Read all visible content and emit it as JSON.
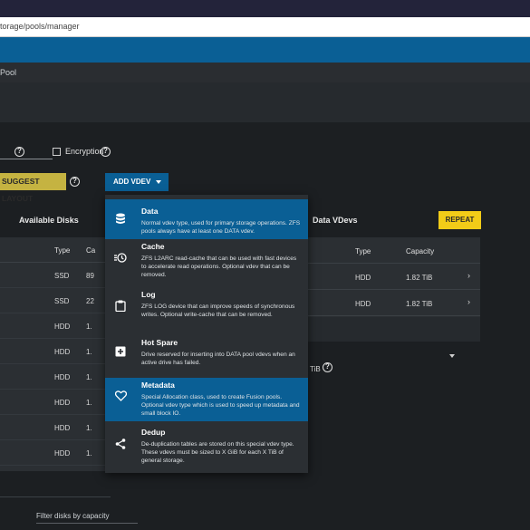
{
  "browser": {
    "url": "torage/pools/manager"
  },
  "breadcrumb": {
    "text": "Pool"
  },
  "form": {
    "encryption_label": "Encryption",
    "help_glyph": "?"
  },
  "toolbar": {
    "suggest_layout_label": "SUGGEST LAYOUT",
    "add_vdev_label": "ADD VDEV"
  },
  "available_disks": {
    "title": "Available Disks",
    "columns": [
      "Type",
      "Ca"
    ],
    "rows": [
      {
        "type": "SSD",
        "cap": "89"
      },
      {
        "type": "SSD",
        "cap": "22"
      },
      {
        "type": "HDD",
        "cap": "1."
      },
      {
        "type": "HDD",
        "cap": "1."
      },
      {
        "type": "HDD",
        "cap": "1."
      },
      {
        "type": "HDD",
        "cap": "1."
      },
      {
        "type": "HDD",
        "cap": "1."
      },
      {
        "type": "HDD",
        "cap": "1."
      }
    ],
    "filter_label": "Filter disks by capacity"
  },
  "data_vdevs": {
    "title": "Data VDevs",
    "repeat_label": "REPEAT",
    "columns": [
      "Type",
      "Capacity"
    ],
    "rows": [
      {
        "type": "HDD",
        "capacity": "1.82 TiB"
      },
      {
        "type": "HDD",
        "capacity": "1.82 TiB"
      }
    ],
    "estimated_label": "TiB"
  },
  "vdev_menu": {
    "items": [
      {
        "icon": "database-icon",
        "title": "Data",
        "desc": "Normal vdev type, used for primary storage operations. ZFS pools always have at least one DATA vdev.",
        "selected": true
      },
      {
        "icon": "cache-icon",
        "title": "Cache",
        "desc": "ZFS L2ARC read-cache that can be used with fast devices to accelerate read operations. Optional vdev that can be removed.",
        "selected": false
      },
      {
        "icon": "clipboard-icon",
        "title": "Log",
        "desc": "ZFS LOG device that can improve speeds of synchronous writes. Optional write-cache that can be removed.",
        "selected": false
      },
      {
        "icon": "plus-box-icon",
        "title": "Hot Spare",
        "desc": "Drive reserved for inserting into DATA pool vdevs when an active drive has failed.",
        "selected": false
      },
      {
        "icon": "heart-icon",
        "title": "Metadata",
        "desc": "Special Allocation class, used to create Fusion pools. Optional vdev type which is used to speed up metadata and small block IO.",
        "selected": true
      },
      {
        "icon": "share-icon",
        "title": "Dedup",
        "desc": "De-duplication tables are stored on this special vdev type. These vdevs must be sized to X GiB for each X TiB of general storage.",
        "selected": false
      }
    ]
  }
}
